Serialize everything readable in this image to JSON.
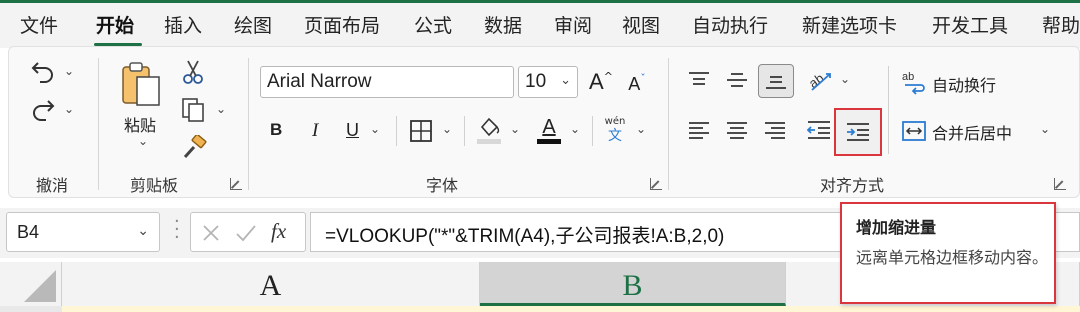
{
  "tabs": [
    {
      "label": "文件"
    },
    {
      "label": "开始"
    },
    {
      "label": "插入"
    },
    {
      "label": "绘图"
    },
    {
      "label": "页面布局"
    },
    {
      "label": "公式"
    },
    {
      "label": "数据"
    },
    {
      "label": "审阅"
    },
    {
      "label": "视图"
    },
    {
      "label": "自动执行"
    },
    {
      "label": "新建选项卡"
    },
    {
      "label": "开发工具"
    },
    {
      "label": "帮助"
    }
  ],
  "active_tab": "开始",
  "ribbon": {
    "undo_group": {
      "label": "撤消"
    },
    "clipboard": {
      "label": "剪贴板",
      "paste_label": "粘贴"
    },
    "font": {
      "label": "字体",
      "font_name": "Arial Narrow",
      "font_size": "10",
      "grow_glyph": "A",
      "shrink_glyph": "A",
      "bold": "B",
      "italic": "I",
      "underline": "U",
      "font_color_glyph": "A",
      "phonetic_top": "wén",
      "phonetic_bottom": "文"
    },
    "alignment": {
      "label": "对齐方式",
      "wrap_text": "自动换行",
      "merge_center": "合并后居中"
    }
  },
  "formula_bar": {
    "name_box": "B4",
    "fx_label": "fx",
    "formula": "=VLOOKUP(\"*\"&TRIM(A4),子公司报表!A:B,2,0)"
  },
  "columns": [
    {
      "label": "A",
      "selected": false
    },
    {
      "label": "B",
      "selected": true
    }
  ],
  "tooltip": {
    "title": "增加缩进量",
    "description": "远离单元格边框移动内容。"
  },
  "colors": {
    "accent": "#1e7145",
    "highlight": "#d9363e"
  }
}
